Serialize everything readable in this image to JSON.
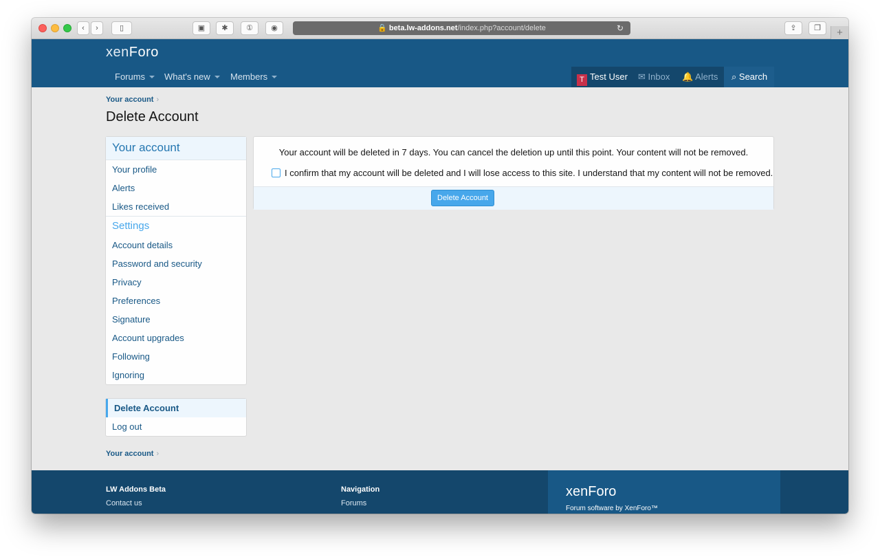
{
  "browser": {
    "url_host": "beta.lw-addons.net",
    "url_path": "/index.php?account/delete",
    "new_tab_label": "+"
  },
  "header": {
    "logo_xen": "xen",
    "logo_foro": "Foro"
  },
  "nav": {
    "items": [
      "Forums",
      "What's new",
      "Members"
    ]
  },
  "userbar": {
    "avatar_letter": "T",
    "username": "Test User",
    "inbox": "Inbox",
    "alerts": "Alerts",
    "search": "Search"
  },
  "page": {
    "breadcrumb": "Your account",
    "breadcrumb_sep": "›",
    "title": "Delete Account"
  },
  "sidebar": {
    "heading": "Your account",
    "items": [
      "Your profile",
      "Alerts",
      "Likes received"
    ],
    "settings_heading": "Settings",
    "settings_items": [
      "Account details",
      "Password and security",
      "Privacy",
      "Preferences",
      "Signature",
      "Account upgrades",
      "Following",
      "Ignoring"
    ]
  },
  "sidebar2": {
    "active": "Delete Account",
    "logout": "Log out"
  },
  "main": {
    "message": "Your account will be deleted in 7 days. You can cancel the deletion up until this point. Your content will not be removed.",
    "confirm_label": "I confirm that my account will be deleted and I will lose access to this site. I understand that my content will not be removed.",
    "button": "Delete Account"
  },
  "footer": {
    "col1_heading": "LW Addons Beta",
    "col1_link": "Contact us",
    "col2_heading": "Navigation",
    "col2_link": "Forums",
    "logo_xen": "xen",
    "logo_foro": "Foro",
    "tagline": "Forum software by XenForo™"
  },
  "colors": {
    "header_blue": "#185886",
    "accent": "#47a7eb",
    "userbar_dark": "#14476c"
  }
}
